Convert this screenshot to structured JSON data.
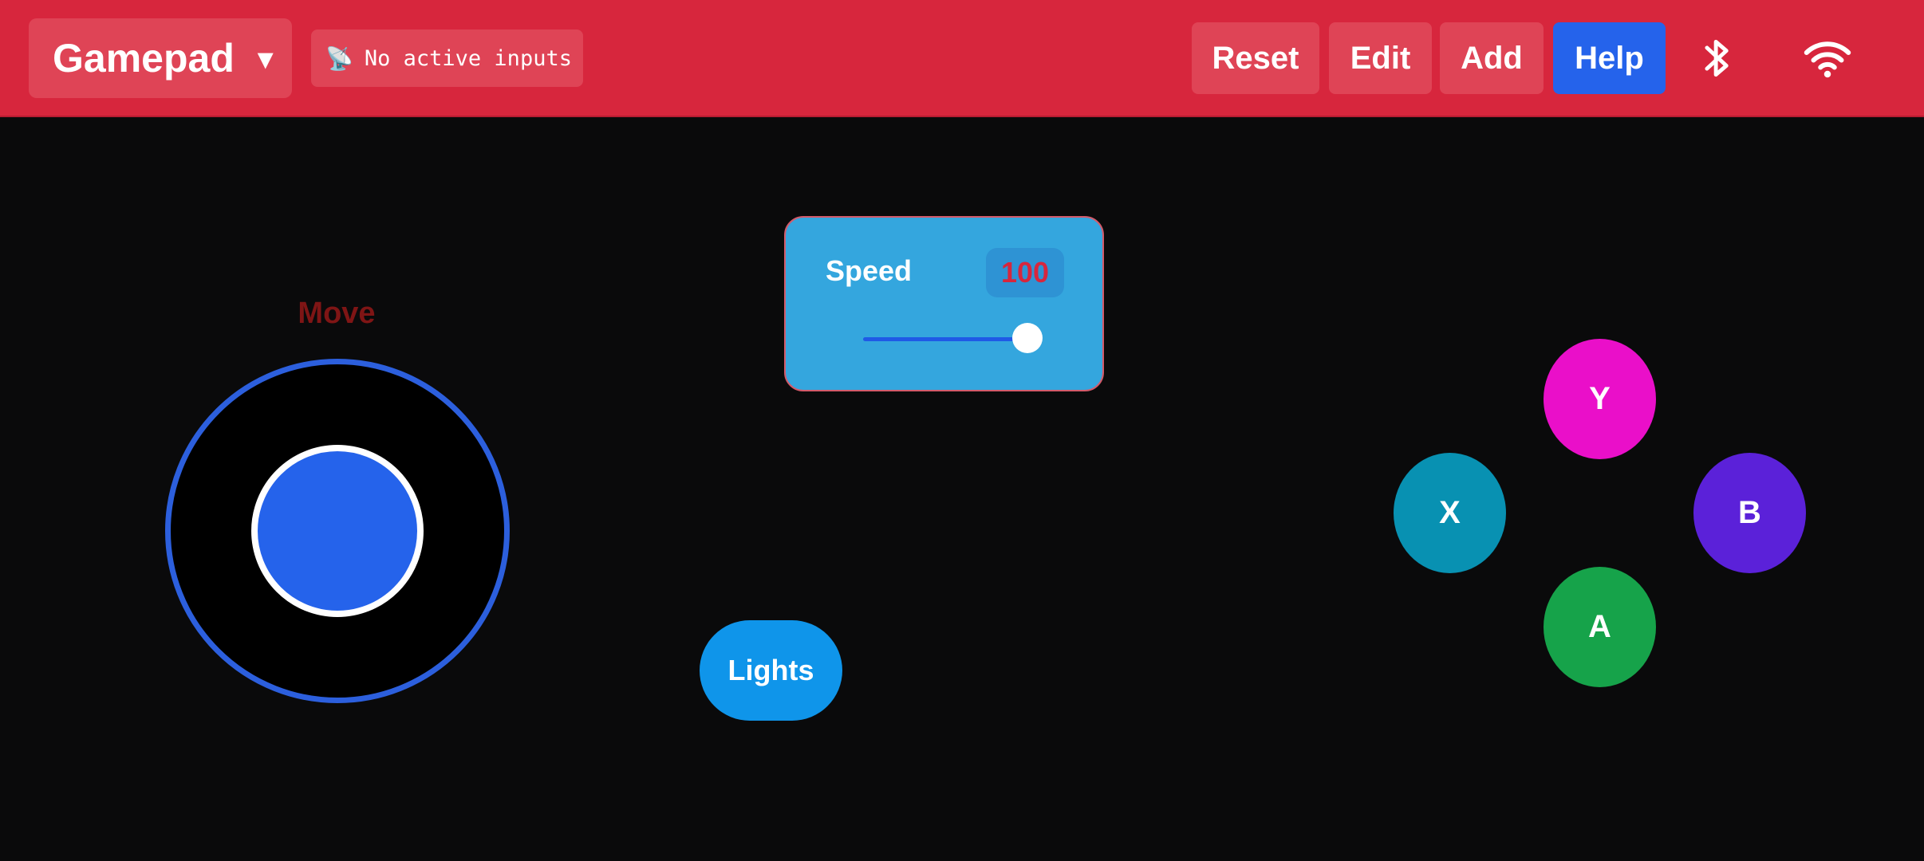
{
  "topbar": {
    "profile": {
      "label": "Gamepad",
      "caret": "▼"
    },
    "status": {
      "icon": "satellite-antenna-icon",
      "glyph": "📡",
      "text": "No active inputs"
    },
    "buttons": {
      "reset": "Reset",
      "edit": "Edit",
      "add": "Add",
      "help": "Help"
    },
    "icons": [
      "bluetooth-icon",
      "wifi-icon"
    ],
    "colors": {
      "bar": "#d7263d",
      "button": "#df4456",
      "help": "#2563eb"
    }
  },
  "controls": {
    "joystick": {
      "label": "Move",
      "ring_color": "#2c5fdd",
      "knob_color": "#2563eb"
    },
    "speed_slider": {
      "label": "Speed",
      "value": "100",
      "level": 1.0,
      "card_color": "#34a6de"
    },
    "lights_button": {
      "label": "Lights",
      "color": "#0f95ea"
    },
    "face_buttons": {
      "y": {
        "label": "Y",
        "color": "#ea0fc9"
      },
      "x": {
        "label": "X",
        "color": "#0891b2"
      },
      "b": {
        "label": "B",
        "color": "#5b21d9"
      },
      "a": {
        "label": "A",
        "color": "#16a34a"
      }
    }
  }
}
